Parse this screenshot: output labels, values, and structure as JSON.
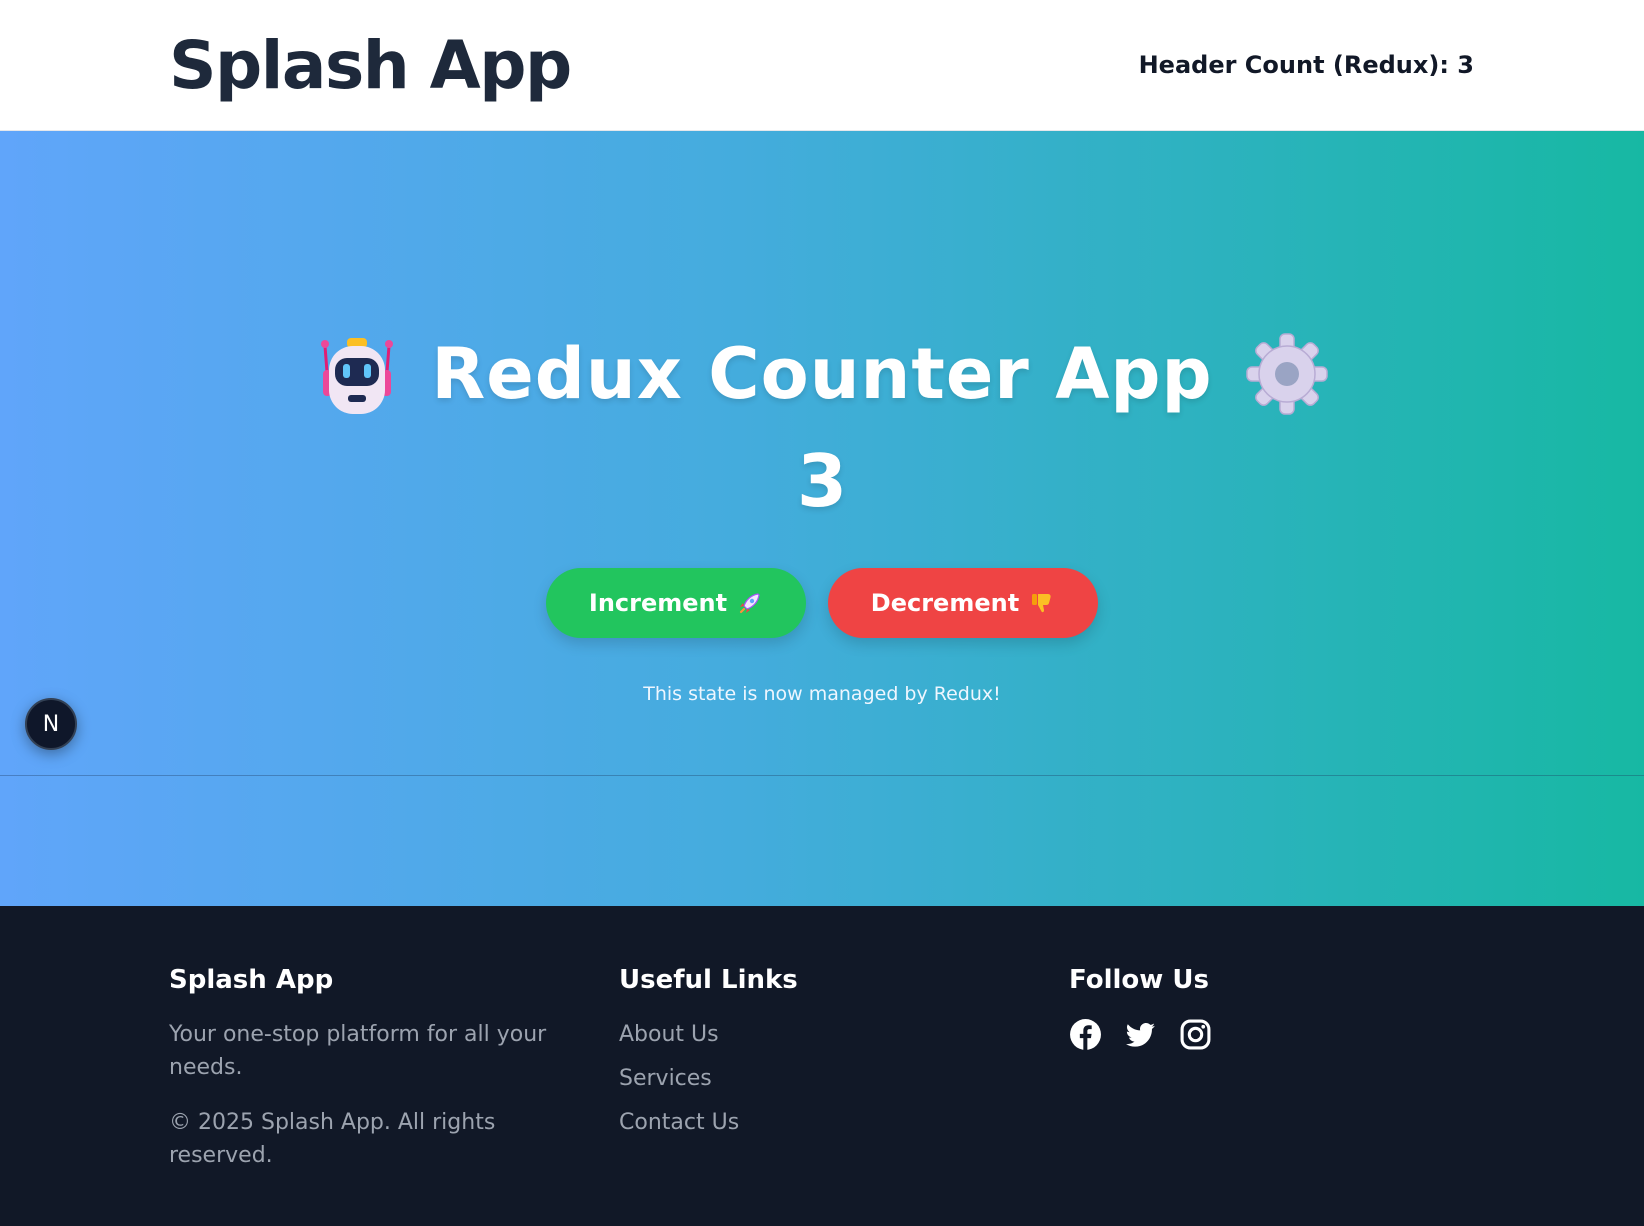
{
  "header": {
    "brand": "Splash App",
    "count_text": "Header Count (Redux): 3"
  },
  "hero": {
    "title": "Redux Counter App",
    "title_left_icon": "robot-icon",
    "title_right_icon": "gear-icon",
    "count": "3",
    "increment_label": "Increment",
    "increment_icon": "rocket-icon",
    "decrement_label": "Decrement",
    "decrement_icon": "thumbs-down-icon",
    "note": "This state is now managed by Redux!"
  },
  "dev_badge": {
    "letter": "N"
  },
  "footer": {
    "brand": "Splash App",
    "tagline": "Your one-stop platform for all your needs.",
    "copyright": "© 2025 Splash App. All rights reserved.",
    "links_heading": "Useful Links",
    "links": [
      "About Us",
      "Services",
      "Contact Us"
    ],
    "follow_heading": "Follow Us",
    "social_icons": [
      "facebook-icon",
      "twitter-icon",
      "instagram-icon"
    ]
  },
  "colors": {
    "increment": "#22c55e",
    "decrement": "#ef4444",
    "footer_bg": "#111827",
    "gradient_start": "#60a5fa",
    "gradient_end": "#14b8a6"
  }
}
